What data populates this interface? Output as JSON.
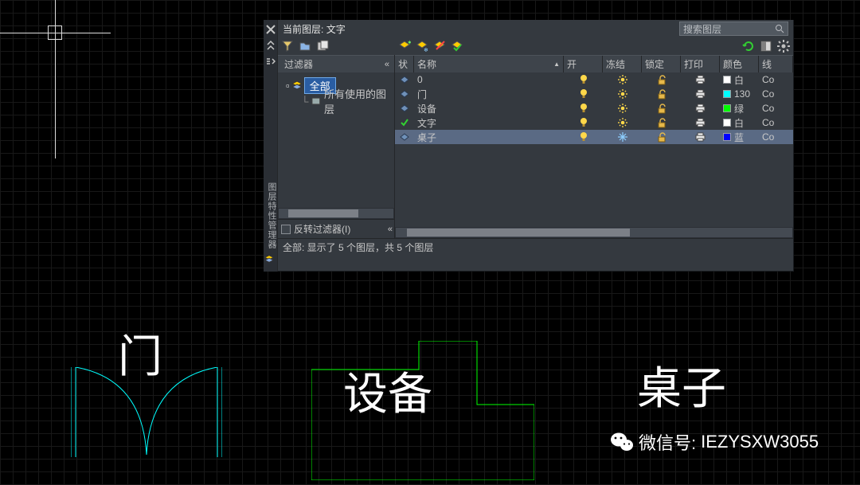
{
  "header": {
    "current_layer_prefix": "当前图层:",
    "current_layer_name": "文字",
    "search_placeholder": "搜索图层"
  },
  "panel": {
    "vertical_title": "图层特性管理器"
  },
  "filter": {
    "title": "过滤器",
    "all_label": "全部",
    "used_label": "所有使用的图层",
    "invert_label": "反转过滤器(I)"
  },
  "columns": {
    "status": "状",
    "name": "名称",
    "on": "开",
    "freeze": "冻结",
    "lock": "锁定",
    "print": "打印",
    "color": "颜色",
    "linetype": "线"
  },
  "layers": [
    {
      "status": "layer",
      "name": "0",
      "on": true,
      "frozen": false,
      "locked": false,
      "print": true,
      "swatch": "#ffffff",
      "color_name": "白",
      "linetype": "Co"
    },
    {
      "status": "layer",
      "name": "门",
      "on": true,
      "frozen": false,
      "locked": false,
      "print": true,
      "swatch": "#00ffff",
      "color_name": "130",
      "linetype": "Co"
    },
    {
      "status": "layer",
      "name": "设备",
      "on": true,
      "frozen": false,
      "locked": false,
      "print": true,
      "swatch": "#00ff00",
      "color_name": "绿",
      "linetype": "Co"
    },
    {
      "status": "current",
      "name": "文字",
      "on": true,
      "frozen": false,
      "locked": false,
      "print": true,
      "swatch": "#ffffff",
      "color_name": "白",
      "linetype": "Co"
    },
    {
      "status": "layer",
      "name": "桌子",
      "on": true,
      "frozen": true,
      "locked": false,
      "print": true,
      "swatch": "#0000ff",
      "color_name": "蓝",
      "linetype": "Co",
      "selected": true
    }
  ],
  "status_bar": "全部: 显示了 5 个图层，共 5 个图层",
  "drawing": {
    "door_label": "门",
    "equipment_label": "设备",
    "desk_label": "桌子"
  },
  "wechat": {
    "prefix": "微信号:",
    "id": "IEZYSXW3055"
  }
}
